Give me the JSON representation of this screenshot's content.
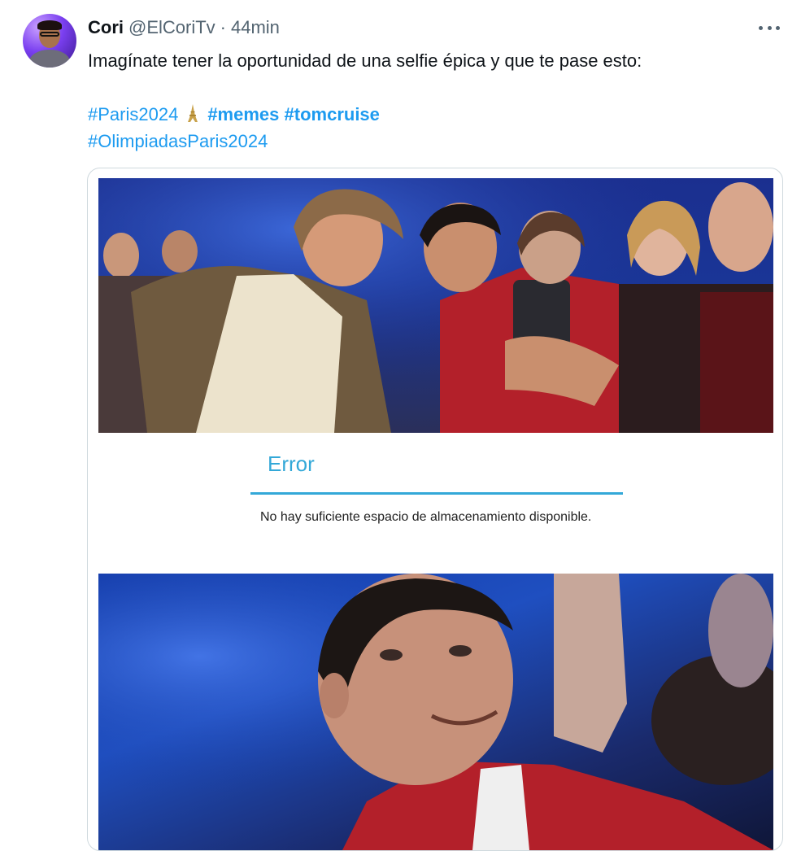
{
  "tweet": {
    "display_name": "Cori",
    "handle": "@ElCoriTv",
    "separator": "·",
    "timestamp": "44min",
    "text": "Imagínate tener la oportunidad de una selfie épica y que te pase esto:",
    "hashtags": {
      "paris": "#Paris2024",
      "memes": "#memes",
      "tomcruise": "#tomcruise",
      "olimpiadas": "#OlimpiadasParis2024"
    },
    "emoji": "eiffel-tower-icon"
  },
  "meme": {
    "dialog_title": "Error",
    "dialog_message": "No hay suficiente espacio de almacenamiento disponible."
  },
  "colors": {
    "accent": "#1d9bf0",
    "dialog_accent": "#33a8d8",
    "secondary_text": "#536471"
  }
}
